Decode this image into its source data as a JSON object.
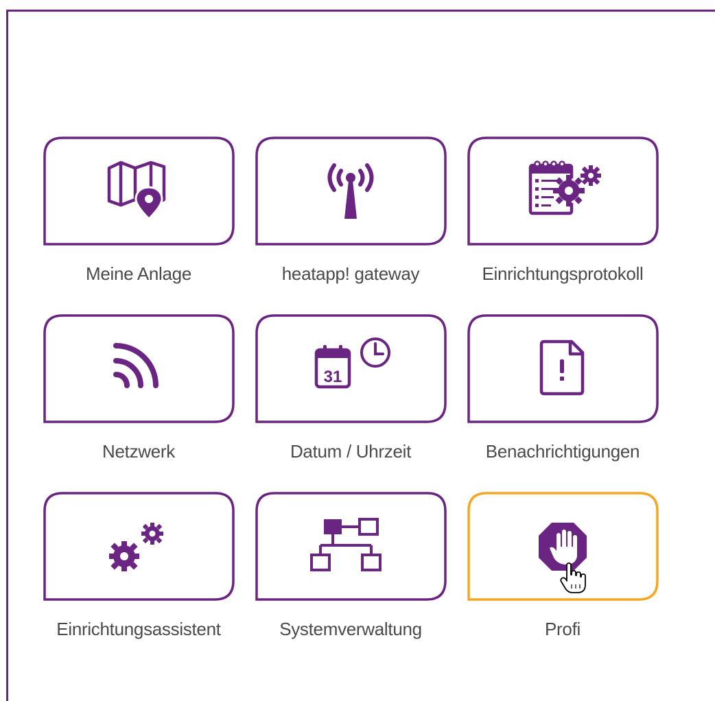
{
  "tiles": [
    {
      "label": "Meine Anlage",
      "icon": "map-pin-icon"
    },
    {
      "label": "heatapp! gateway",
      "icon": "antenna-icon"
    },
    {
      "label": "Einrichtungsprotokoll",
      "icon": "calendar-gear-icon"
    },
    {
      "label": "Netzwerk",
      "icon": "wifi-icon"
    },
    {
      "label": "Datum / Uhrzeit",
      "icon": "calendar-clock-icon"
    },
    {
      "label": "Benachrichtigungen",
      "icon": "document-alert-icon"
    },
    {
      "label": "Einrichtungsassistent",
      "icon": "gears-icon"
    },
    {
      "label": "Systemverwaltung",
      "icon": "network-icon"
    },
    {
      "label": "Profi",
      "icon": "stop-hand-icon",
      "state": "hover"
    }
  ],
  "calendar_day": "31",
  "colors": {
    "accent": "#6a2482",
    "hover_border": "#f5a623",
    "label_text": "#4a4a4a",
    "frame": "#6a2482"
  }
}
